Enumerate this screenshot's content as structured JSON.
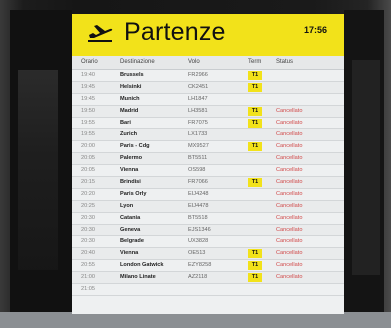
{
  "board": {
    "title": "Partenze",
    "clock": "17:56",
    "plane_icon": "airplane-departure-icon",
    "colors": {
      "header": "#f2e21a",
      "terminal_badge": "#f2e21a",
      "cancelled": "#d14a4a"
    },
    "columns": {
      "time": "Orario",
      "destination": "Destinazione",
      "flight": "Volo",
      "terminal": "Term",
      "status": "Status"
    },
    "flights": [
      {
        "time": "19:40",
        "destination": "Brussels",
        "flight": "FR2966",
        "terminal": "T1",
        "status": ""
      },
      {
        "time": "19:45",
        "destination": "Helsinki",
        "flight": "CK2451",
        "terminal": "T1",
        "status": ""
      },
      {
        "time": "19:45",
        "destination": "Munich",
        "flight": "LH1847",
        "terminal": "",
        "status": ""
      },
      {
        "time": "19:50",
        "destination": "Madrid",
        "flight": "LH3581",
        "terminal": "T1",
        "status": "Cancellato"
      },
      {
        "time": "19:55",
        "destination": "Bari",
        "flight": "FR7075",
        "terminal": "T1",
        "status": "Cancellato"
      },
      {
        "time": "19:55",
        "destination": "Zurich",
        "flight": "LX1733",
        "terminal": "",
        "status": "Cancellato"
      },
      {
        "time": "20:00",
        "destination": "Paris - Cdg",
        "flight": "MX9527",
        "terminal": "T1",
        "status": "Cancellato"
      },
      {
        "time": "20:05",
        "destination": "Palermo",
        "flight": "BT5511",
        "terminal": "",
        "status": "Cancellato"
      },
      {
        "time": "20:05",
        "destination": "Vienna",
        "flight": "OS598",
        "terminal": "",
        "status": "Cancellato"
      },
      {
        "time": "20:15",
        "destination": "Brindisi",
        "flight": "FR7066",
        "terminal": "T1",
        "status": "Cancellato"
      },
      {
        "time": "20:20",
        "destination": "Paris Orly",
        "flight": "EIJ4248",
        "terminal": "",
        "status": "Cancellato"
      },
      {
        "time": "20:25",
        "destination": "Lyon",
        "flight": "EIJ4478",
        "terminal": "",
        "status": "Cancellato"
      },
      {
        "time": "20:30",
        "destination": "Catania",
        "flight": "BT5518",
        "terminal": "",
        "status": "Cancellato"
      },
      {
        "time": "20:30",
        "destination": "Geneva",
        "flight": "EJS1346",
        "terminal": "",
        "status": "Cancellato"
      },
      {
        "time": "20:30",
        "destination": "Belgrade",
        "flight": "UX3828",
        "terminal": "",
        "status": "Cancellato"
      },
      {
        "time": "20:40",
        "destination": "Vienna",
        "flight": "OE513",
        "terminal": "T1",
        "status": "Cancellato"
      },
      {
        "time": "20:55",
        "destination": "London Gatwick",
        "flight": "EZY8258",
        "terminal": "T1",
        "status": "Cancellato"
      },
      {
        "time": "21:00",
        "destination": "Milano Linate",
        "flight": "AZ2118",
        "terminal": "T1",
        "status": "Cancellato"
      },
      {
        "time": "21:05",
        "destination": "",
        "flight": "",
        "terminal": "",
        "status": ""
      }
    ]
  }
}
